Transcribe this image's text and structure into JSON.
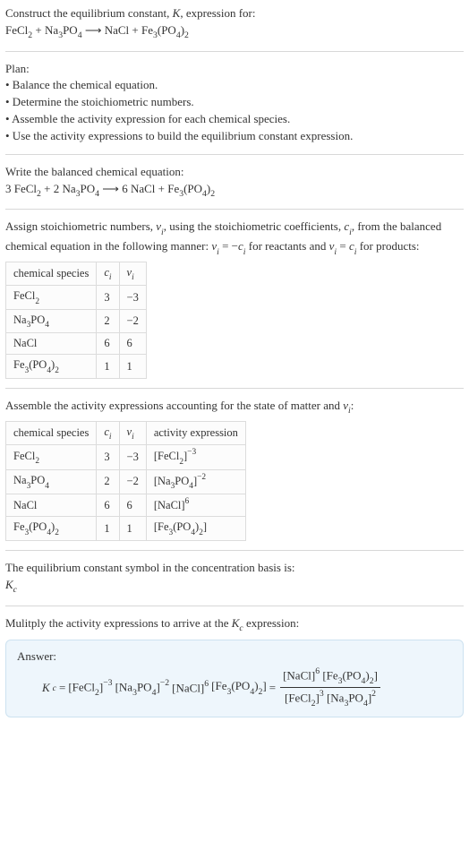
{
  "header": {
    "prompt1": "Construct the equilibrium constant, ",
    "Kvar": "K",
    "prompt2": ", expression for:",
    "reaction_lhs1": "FeCl",
    "reaction_lhs1_sub": "2",
    "reaction_plus1": " + ",
    "reaction_lhs2": "Na",
    "reaction_lhs2_sub": "3",
    "reaction_lhs3": "PO",
    "reaction_lhs3_sub": "4",
    "arrow": "  ⟶  ",
    "reaction_rhs1": "NaCl + Fe",
    "reaction_rhs1_sub": "3",
    "reaction_rhs2": "(PO",
    "reaction_rhs2_sub": "4",
    "reaction_rhs3": ")",
    "reaction_rhs3_sub": "2"
  },
  "plan": {
    "title": "Plan:",
    "b1": "• Balance the chemical equation.",
    "b2": "• Determine the stoichiometric numbers.",
    "b3": "• Assemble the activity expression for each chemical species.",
    "b4": "• Use the activity expressions to build the equilibrium constant expression."
  },
  "balanced": {
    "title": "Write the balanced chemical equation:",
    "c1": "3 FeCl",
    "c1s": "2",
    "c2": " + 2 Na",
    "c2s": "3",
    "c3": "PO",
    "c3s": "4",
    "arrow": "  ⟶  ",
    "c4": "6 NaCl + Fe",
    "c4s": "3",
    "c5": "(PO",
    "c5s": "4",
    "c6": ")",
    "c6s": "2"
  },
  "stoich": {
    "intro1": "Assign stoichiometric numbers, ",
    "v": "ν",
    "i": "i",
    "intro2": ", using the stoichiometric coefficients, ",
    "c": "c",
    "intro3": ", from the balanced chemical equation in the following manner: ",
    "eq1a": "ν",
    "eq1b": " = −",
    "eq1c": "c",
    "intro4": " for reactants and ",
    "eq2a": "ν",
    "eq2b": " = ",
    "eq2c": "c",
    "intro5": " for products:"
  },
  "table1": {
    "h1": "chemical species",
    "h2": "c",
    "h2s": "i",
    "h3": "ν",
    "h3s": "i",
    "rows": [
      {
        "sp1": "FeCl",
        "sp1s": "2",
        "sp2": "",
        "sp2s": "",
        "sp3": "",
        "sp3s": "",
        "ci": "3",
        "vi": "−3"
      },
      {
        "sp1": "Na",
        "sp1s": "3",
        "sp2": "PO",
        "sp2s": "4",
        "sp3": "",
        "sp3s": "",
        "ci": "2",
        "vi": "−2"
      },
      {
        "sp1": "NaCl",
        "sp1s": "",
        "sp2": "",
        "sp2s": "",
        "sp3": "",
        "sp3s": "",
        "ci": "6",
        "vi": "6"
      },
      {
        "sp1": "Fe",
        "sp1s": "3",
        "sp2": "(PO",
        "sp2s": "4",
        "sp3": ")",
        "sp3s": "2",
        "ci": "1",
        "vi": "1"
      }
    ]
  },
  "activity": {
    "intro1": "Assemble the activity expressions accounting for the state of matter and ",
    "v": "ν",
    "i": "i",
    "intro2": ":"
  },
  "table2": {
    "h1": "chemical species",
    "h2": "c",
    "h2s": "i",
    "h3": "ν",
    "h3s": "i",
    "h4": "activity expression",
    "rows": [
      {
        "sp1": "FeCl",
        "sp1s": "2",
        "sp2": "",
        "sp2s": "",
        "sp3": "",
        "sp3s": "",
        "ci": "3",
        "vi": "−3",
        "a1": "[FeCl",
        "a1s": "2",
        "a2": "]",
        "aexp": "−3",
        "a3": "",
        "a3s": "",
        "a4": "",
        "a4s": ""
      },
      {
        "sp1": "Na",
        "sp1s": "3",
        "sp2": "PO",
        "sp2s": "4",
        "sp3": "",
        "sp3s": "",
        "ci": "2",
        "vi": "−2",
        "a1": "[Na",
        "a1s": "3",
        "a2": "PO",
        "aexp": "",
        "a3": "",
        "a3s": "4",
        "a4": "]",
        "a4s": "−2"
      },
      {
        "sp1": "NaCl",
        "sp1s": "",
        "sp2": "",
        "sp2s": "",
        "sp3": "",
        "sp3s": "",
        "ci": "6",
        "vi": "6",
        "a1": "[NaCl]",
        "a1s": "",
        "a2": "",
        "aexp": "6",
        "a3": "",
        "a3s": "",
        "a4": "",
        "a4s": ""
      },
      {
        "sp1": "Fe",
        "sp1s": "3",
        "sp2": "(PO",
        "sp2s": "4",
        "sp3": ")",
        "sp3s": "2",
        "ci": "1",
        "vi": "1",
        "a1": "[Fe",
        "a1s": "3",
        "a2": "(PO",
        "aexp": "",
        "a3": "",
        "a3s": "4",
        "a4": ")",
        "a4s": "2",
        "a5": "]"
      }
    ]
  },
  "kcline": {
    "l1": "The equilibrium constant symbol in the concentration basis is:",
    "K": "K",
    "c": "c"
  },
  "mult": {
    "l1": "Mulitply the activity expressions to arrive at the ",
    "K": "K",
    "c": "c",
    "l2": " expression:"
  },
  "answer": {
    "label": "Answer:",
    "K": "K",
    "c": "c",
    "eq": " = ",
    "t1": "[FeCl",
    "t1s": "2",
    "t1e": "]",
    "t1p": "−3",
    "t2": " [Na",
    "t2s": "3",
    "t2a": "PO",
    "t2as": "4",
    "t2e": "]",
    "t2p": "−2",
    "t3": " [NaCl]",
    "t3p": "6",
    "t4": " [Fe",
    "t4s": "3",
    "t4a": "(PO",
    "t4as": "4",
    "t4b": ")",
    "t4bs": "2",
    "t4e": "]",
    "eq2": " = ",
    "num1": "[NaCl]",
    "num1p": "6",
    "num2": " [Fe",
    "num2s": "3",
    "num2a": "(PO",
    "num2as": "4",
    "num2b": ")",
    "num2bs": "2",
    "num2e": "]",
    "den1": "[FeCl",
    "den1s": "2",
    "den1e": "]",
    "den1p": "3",
    "den2": " [Na",
    "den2s": "3",
    "den2a": "PO",
    "den2as": "4",
    "den2e": "]",
    "den2p": "2"
  }
}
